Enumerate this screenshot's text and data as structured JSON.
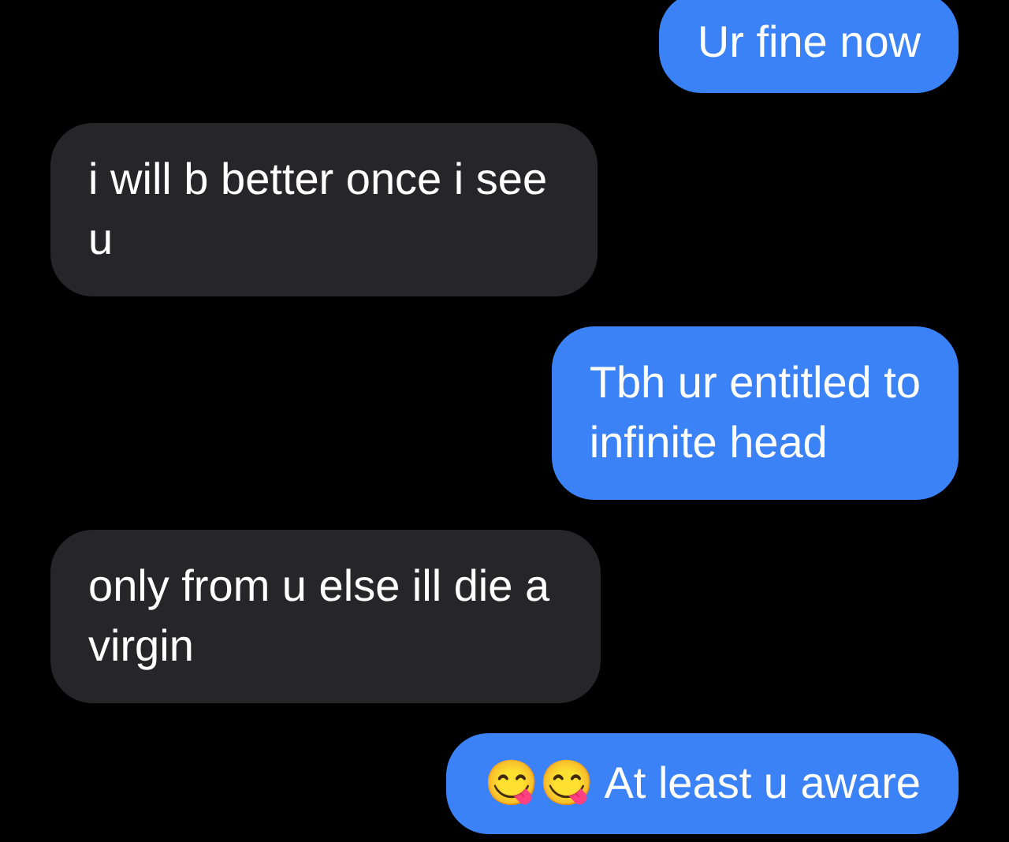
{
  "messages": [
    {
      "kind": "sent",
      "lines": [
        "Ur fine now"
      ]
    },
    {
      "kind": "received",
      "lines": [
        "i will b better once i see",
        "u"
      ]
    },
    {
      "kind": "sent",
      "lines": [
        "Tbh ur entitled to",
        "infinite head"
      ]
    },
    {
      "kind": "received",
      "lines": [
        "only from u else ill die a",
        "virgin"
      ]
    },
    {
      "kind": "sent",
      "lines": [
        "😋😋 At least u aware"
      ]
    }
  ]
}
